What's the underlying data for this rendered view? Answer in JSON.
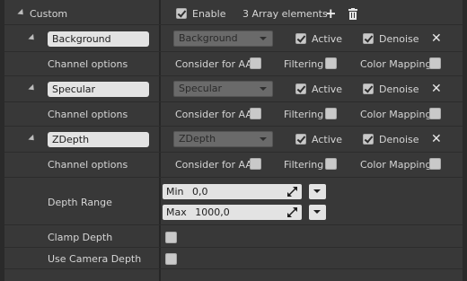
{
  "header": {
    "title": "Custom",
    "enable_label": "Enable",
    "enable_checked": true,
    "array_count": "3 Array elements"
  },
  "channels": [
    {
      "name": "Background",
      "combo_value": "Background",
      "active_label": "Active",
      "active_checked": true,
      "denoise_label": "Denoise",
      "denoise_checked": true,
      "options_label": "Channel options",
      "aa_label": "Consider for AA",
      "aa_checked": false,
      "filtering_label": "Filtering",
      "filtering_checked": false,
      "colormap_label": "Color Mapping",
      "colormap_checked": false
    },
    {
      "name": "Specular",
      "combo_value": "Specular",
      "active_label": "Active",
      "active_checked": true,
      "denoise_label": "Denoise",
      "denoise_checked": true,
      "options_label": "Channel options",
      "aa_label": "Consider for AA",
      "aa_checked": false,
      "filtering_label": "Filtering",
      "filtering_checked": false,
      "colormap_label": "Color Mapping",
      "colormap_checked": false
    },
    {
      "name": "ZDepth",
      "combo_value": "ZDepth",
      "active_label": "Active",
      "active_checked": true,
      "denoise_label": "Denoise",
      "denoise_checked": true,
      "options_label": "Channel options",
      "aa_label": "Consider for AA",
      "aa_checked": false,
      "filtering_label": "Filtering",
      "filtering_checked": false,
      "colormap_label": "Color Mapping",
      "colormap_checked": false
    }
  ],
  "depth": {
    "range_label": "Depth Range",
    "min_label": "Min",
    "min_value": "0,0",
    "max_label": "Max",
    "max_value": "1000,0",
    "clamp_label": "Clamp Depth",
    "clamp_checked": false,
    "camera_label": "Use Camera Depth",
    "camera_checked": false
  }
}
